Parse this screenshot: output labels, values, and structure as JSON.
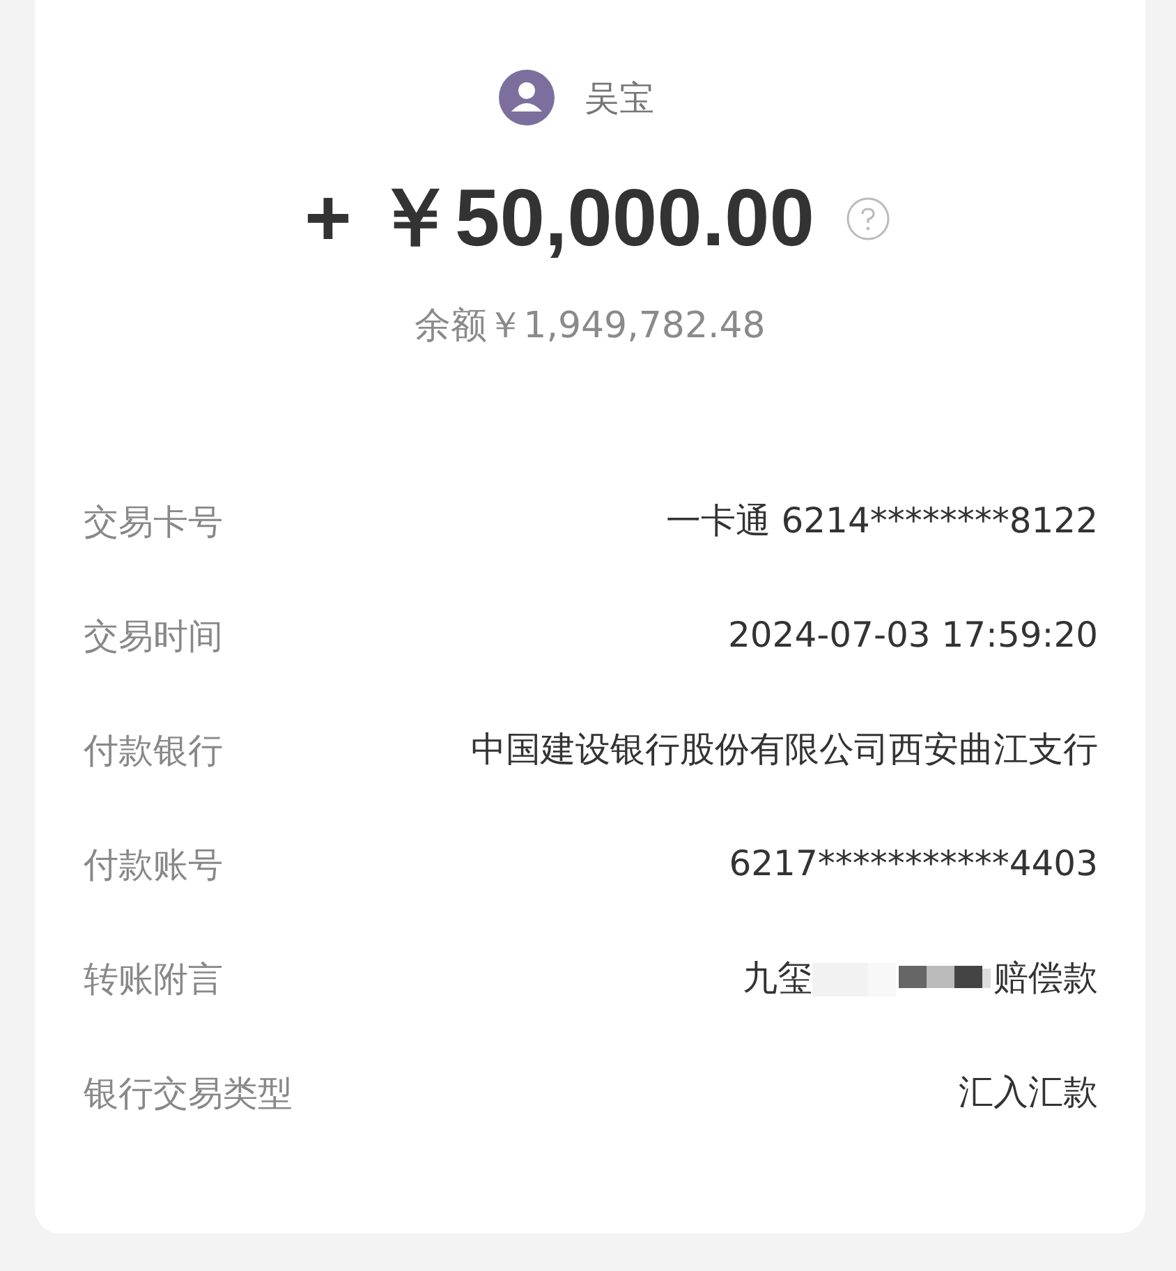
{
  "payee": {
    "name": "吴宝"
  },
  "amount": "+ ￥50,000.00",
  "balance": "余额￥1,949,782.48",
  "details": [
    {
      "kind": "text",
      "label": "交易卡号",
      "value": "一卡通 6214********8122"
    },
    {
      "kind": "text",
      "label": "交易时间",
      "value": "2024-07-03 17:59:20"
    },
    {
      "kind": "text",
      "label": "付款银行",
      "value": "中国建设银行股份有限公司西安曲江支行"
    },
    {
      "kind": "text",
      "label": "付款账号",
      "value": "6217***********4403"
    },
    {
      "kind": "redacted",
      "label": "转账附言",
      "value_start": "九玺",
      "value_end": "赔偿款"
    },
    {
      "kind": "text",
      "label": "银行交易类型",
      "value": "汇入汇款"
    }
  ]
}
